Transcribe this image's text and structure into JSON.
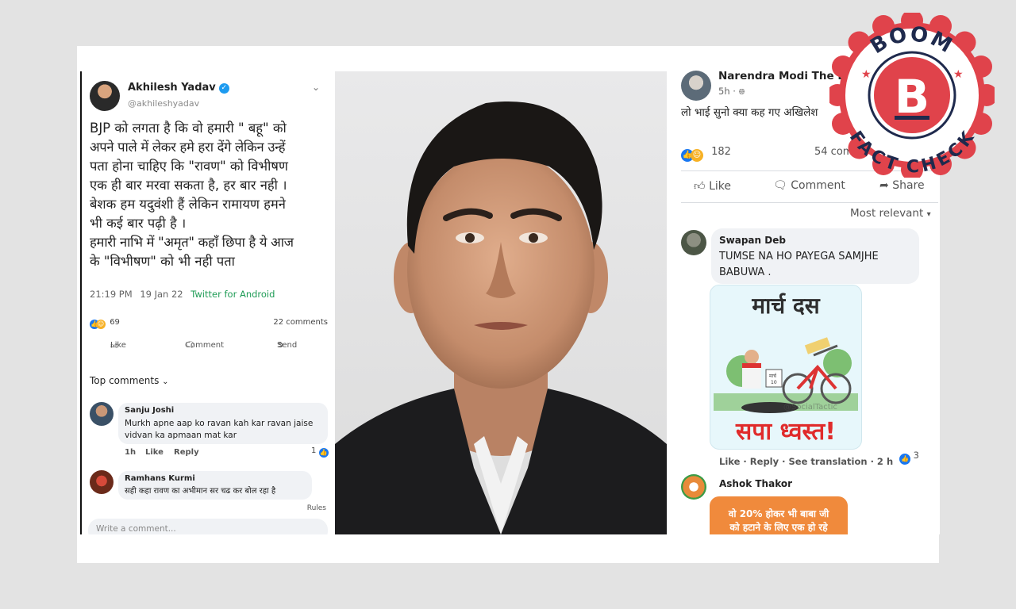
{
  "tweet": {
    "author_name": "Akhilesh Yadav",
    "handle": "@akhileshyadav",
    "lines": [
      "BJP को लगता है कि वो हमारी \" बहू\" को",
      "अपने पाले में लेकर हमे हरा देंगे लेकिन उन्हें",
      "पता होना चाहिए कि \"रावण\" को विभीषण",
      "एक ही बार मरवा सकता है, हर बार नही ।",
      "बेशक हम यदुवंशी हैं लेकिन रामायण हमने",
      "भी कई बार पढ़ी है ।",
      "हमारी नाभि में \"अमृत\" कहाँ छिपा है ये आज",
      "के \"विभीषण\" को भी नही पता"
    ],
    "time": "21:19 PM",
    "date": "19 Jan 22",
    "source": "Twitter for Android",
    "reactions_count": "69",
    "comments_count": "22 comments",
    "actions": {
      "like": "Like",
      "comment": "Comment",
      "send": "Send"
    },
    "top_comments_label": "Top comments",
    "comments": [
      {
        "name": "Sanju Joshi",
        "lines": [
          "Murkh apne aap ko ravan kah kar ravan jaise",
          "vidvan ka apmaan mat kar"
        ],
        "time": "1h",
        "like": "Like",
        "reply": "Reply",
        "count": "1"
      },
      {
        "name": "Ramhans Kurmi",
        "lines": [
          "सही कहा रावण का अभीमान सर चढ कर बोल रहा है"
        ]
      }
    ],
    "rules": "Rules",
    "write_placeholder": "Write a comment..."
  },
  "facebook": {
    "page_name": "Narendra Modi The Lo",
    "time": "5h ·",
    "post_text": "लो भाई सुनो क्या कह गए अखिलेश",
    "reactions_count": "182",
    "comments_count": "54 comm",
    "actions": {
      "like": "Like",
      "comment": "Comment",
      "share": "Share"
    },
    "sort": "Most relevant",
    "comments": [
      {
        "name": "Swapan Deb",
        "lines": [
          "TUMSE NA HO PAYEGA SAMJHE",
          "BABUWA ."
        ]
      },
      {
        "name": "Ashok Thakor"
      }
    ],
    "sticker": {
      "title": "मार्च दस",
      "caption": "सपा ध्वस्त!",
      "small_label_1": "मार्च",
      "small_label_2": "10",
      "watermark": "@SocialTactic"
    },
    "comment_meta": "Like · Reply · See translation · 2 h",
    "comment_reactions": "3",
    "orange_card_lines": [
      "वो 20% होकर भी बाबा जी",
      "को हटाने के लिए एक हो रहे"
    ]
  },
  "badge": {
    "top_text": "BOOM",
    "letter": "B",
    "bottom_text": "FACT CHECK",
    "red": "#e0434b",
    "navy": "#1f2a4d"
  },
  "icons": [
    "verified-icon",
    "chevron-down-icon",
    "like-icon",
    "comment-icon",
    "send-icon",
    "share-icon",
    "globe-icon",
    "haha-reaction-icon"
  ]
}
